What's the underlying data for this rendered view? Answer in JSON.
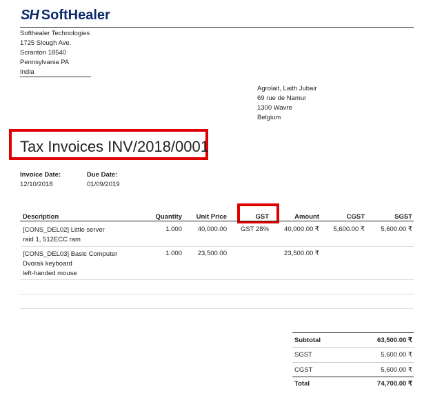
{
  "brand": {
    "mark": "SH",
    "name": "SoftHealer"
  },
  "company": {
    "lines": [
      "Softhealer Technologies",
      "1725 Slough Ave.",
      "Scranton 18540",
      "Pennsylvania PA",
      "India"
    ]
  },
  "partner": {
    "lines": [
      "Agrolait, Laith Jubair",
      "69 rue de Namur",
      "1300 Wavre",
      "Belgium"
    ]
  },
  "document": {
    "title": "Tax Invoices INV/2018/0001"
  },
  "dates": {
    "invoice_label": "Invoice Date:",
    "invoice_value": "12/10/2018",
    "due_label": "Due Date:",
    "due_value": "01/09/2019"
  },
  "table": {
    "headers": {
      "description": "Description",
      "quantity": "Quantity",
      "unit_price": "Unit Price",
      "gst": "GST",
      "amount": "Amount",
      "cgst": "CGST",
      "sgst": "SGST"
    },
    "rows": [
      {
        "description": [
          "[CONS_DEL02] Little server",
          "raid 1, 512ECC ram"
        ],
        "quantity": "1.000",
        "unit_price": "40,000.00",
        "gst": "GST 28%",
        "amount": "40,000.00 ₹",
        "cgst": "5,600.00 ₹",
        "sgst": "5,600.00 ₹"
      },
      {
        "description": [
          "[CONS_DEL03] Basic Computer",
          "Dvorak keyboard",
          "left-handed mouse"
        ],
        "quantity": "1.000",
        "unit_price": "23,500.00",
        "gst": "",
        "amount": "23,500.00 ₹",
        "cgst": "",
        "sgst": ""
      }
    ]
  },
  "totals": [
    {
      "label": "Subtotal",
      "value": "63,500.00 ₹"
    },
    {
      "label": "SGST",
      "value": "5,600.00 ₹"
    },
    {
      "label": "CGST",
      "value": "5,600.00 ₹"
    },
    {
      "label": "Total",
      "value": "74,700.00 ₹"
    }
  ]
}
